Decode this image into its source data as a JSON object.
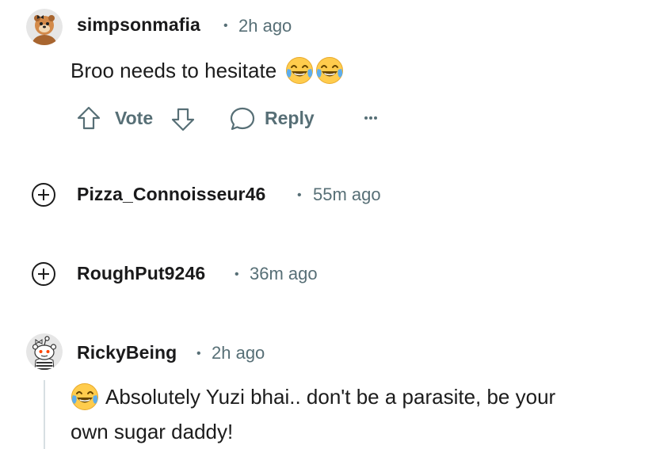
{
  "comments": [
    {
      "username": "simpsonmafia",
      "time": "2h ago",
      "text": "Broo needs to hesitate",
      "vote_label": "Vote",
      "reply_label": "Reply",
      "more_label": "···"
    },
    {
      "username": "Pizza_Connoisseur46",
      "time": "55m ago"
    },
    {
      "username": "RoughPut9246",
      "time": "36m ago"
    },
    {
      "username": "RickyBeing",
      "time": "2h ago",
      "text_line1": "Absolutely Yuzi bhai.. don't be a parasite, be your",
      "text_line2": "own sugar daddy!"
    }
  ],
  "separator": "•",
  "colors": {
    "meta": "#576f76",
    "thread_line": "#d7dfe2",
    "emoji_face": "#ffcc4d"
  },
  "icons": {
    "upvote": "arrow-up-outline",
    "downvote": "arrow-down-outline",
    "reply": "speech-bubble",
    "expand": "plus-circle",
    "more": "ellipsis"
  }
}
